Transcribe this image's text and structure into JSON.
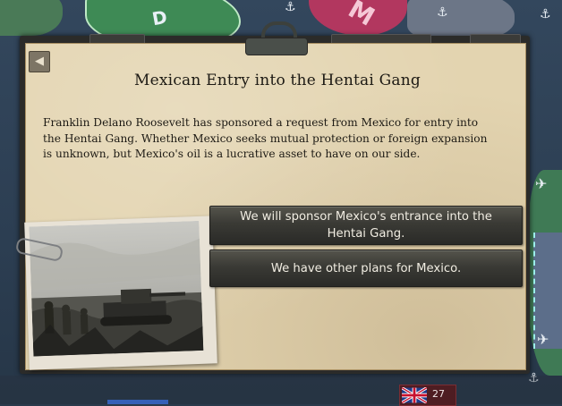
{
  "event": {
    "title": "Mexican Entry into the Hentai Gang",
    "description": "Franklin Delano Roosevelt has sponsored a request from Mexico for entry into the Hentai Gang. Whether Mexico seeks mutual protection or foreign expansion is unknown, but Mexico's oil is a lucrative asset to have on our side.",
    "back_icon": "◀",
    "options": [
      {
        "label": "We will sponsor Mexico's entrance into the Hentai Gang."
      },
      {
        "label": "We have other plans for Mexico."
      }
    ]
  },
  "map": {
    "labels": [
      "D",
      "M"
    ],
    "unit_icons": [
      "air-wing-icon",
      "naval-anchor-icon",
      "anchor-icon"
    ]
  },
  "topbar": {
    "flag": "united-kingdom-flag",
    "count": "27"
  },
  "colors": {
    "parchment": "#e3d4b0",
    "button": "#3a3a35",
    "button_text": "#f1ede2",
    "map_sea": "#2c3e52"
  }
}
